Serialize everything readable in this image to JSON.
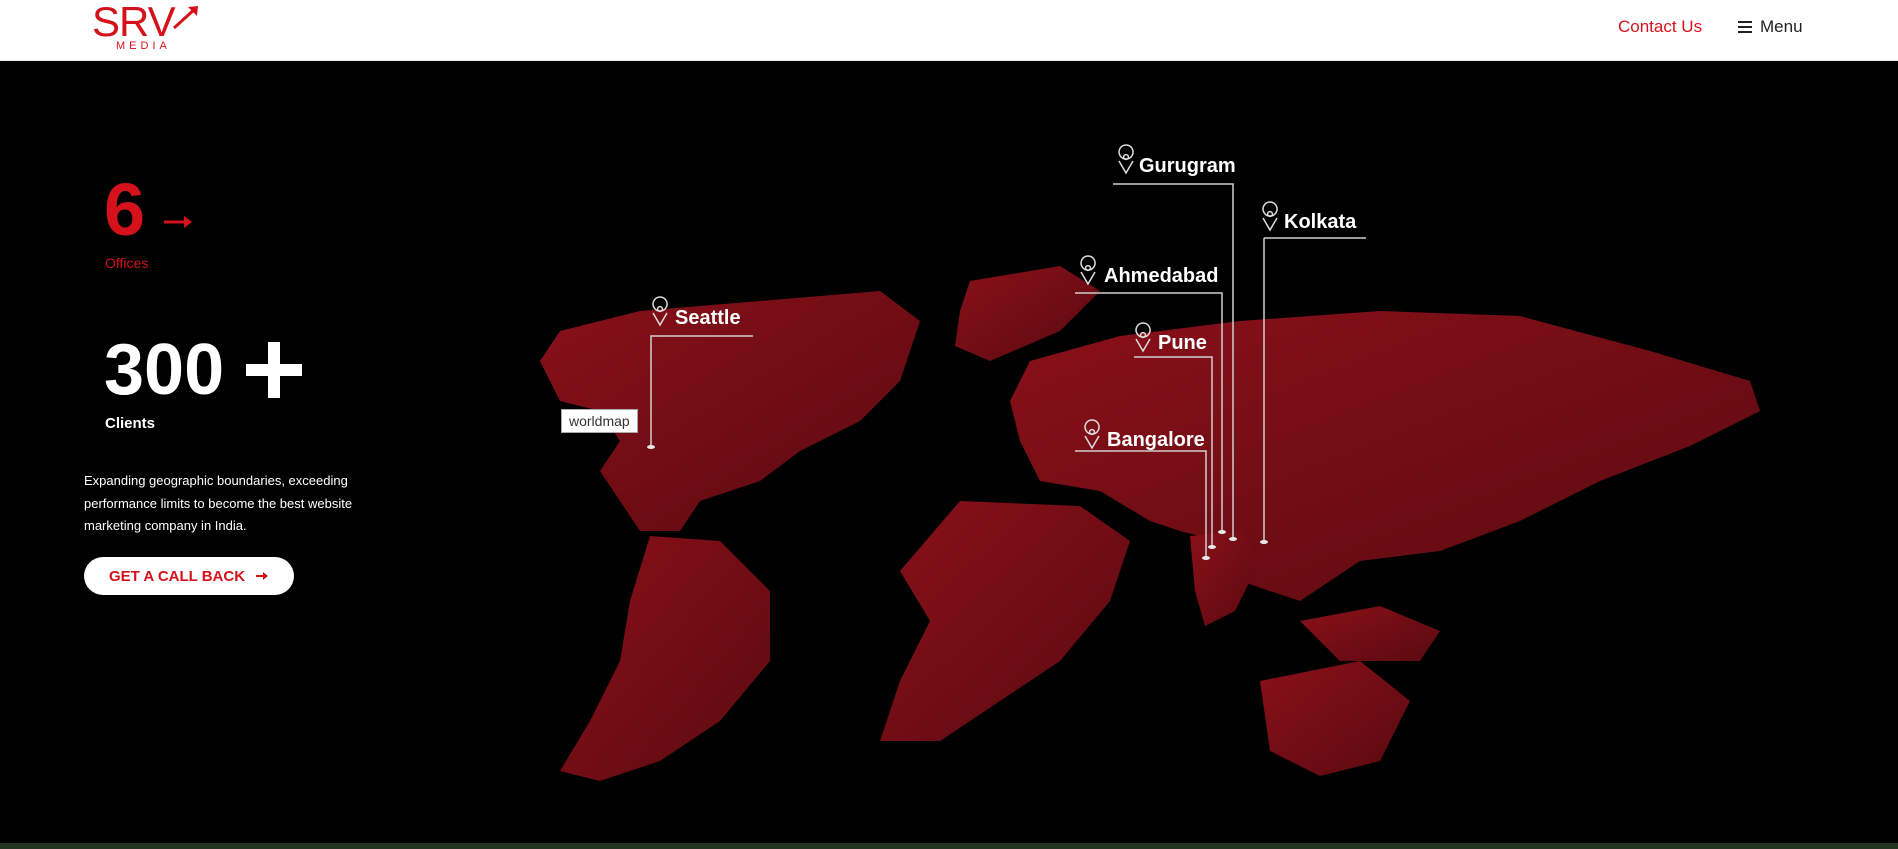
{
  "header": {
    "logo_text": "SRV",
    "logo_subtext": "MEDIA",
    "contact_label": "Contact Us",
    "menu_label": "Menu"
  },
  "stats": {
    "offices_value": "6",
    "offices_label": "Offices",
    "clients_value": "300",
    "clients_label": "Clients"
  },
  "tagline": "Expanding geographic boundaries, exceeding performance limits to become the best website marketing company in India.",
  "cta": {
    "label": "GET A CALL BACK"
  },
  "map": {
    "alt_text": "worldmap",
    "cities": [
      "Gurugram",
      "Kolkata",
      "Ahmedabad",
      "Seattle",
      "Pune",
      "Bangalore"
    ]
  },
  "colors": {
    "brand_red": "#d5121b",
    "map_red": "#6e0d14",
    "background": "#000000"
  },
  "icons": [
    "hamburger-icon",
    "arrow-right-icon",
    "plus-icon",
    "map-pin-icon",
    "logo-arrow-icon"
  ]
}
